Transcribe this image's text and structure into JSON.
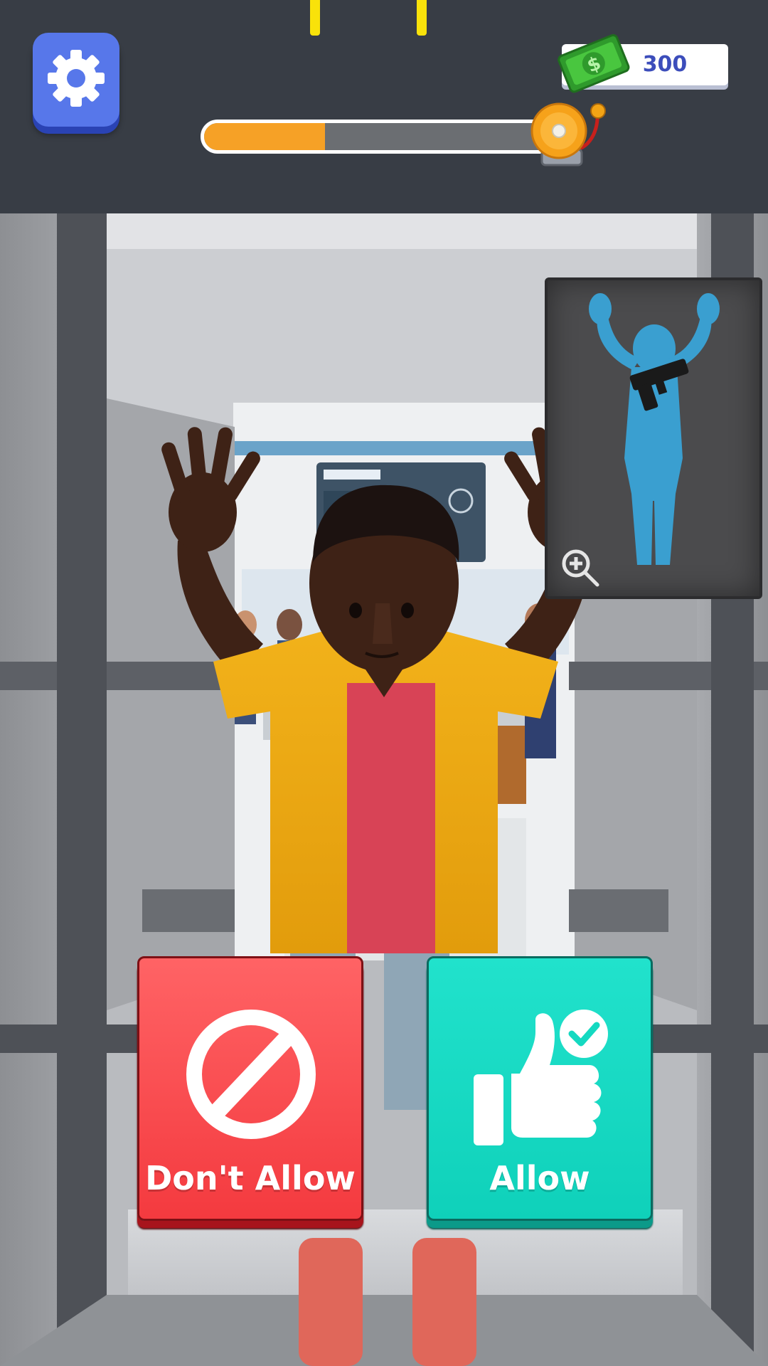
{
  "hud": {
    "settings_icon": "gear-icon",
    "money": {
      "icon": "cash-bill-icon",
      "amount": "300"
    },
    "progress": {
      "fraction": 0.34,
      "milestones": 2,
      "goal_icon": "alarm-bell-icon"
    }
  },
  "xray": {
    "icon": "zoom-in-icon",
    "contraband_icon": "gun-icon",
    "silhouette_color": "#3a9fd0"
  },
  "buttons": {
    "deny": {
      "label": "Don't Allow",
      "icon": "prohibited-icon",
      "color": "#f43a3f"
    },
    "allow": {
      "label": "Allow",
      "icon": "thumbs-up-check-icon",
      "color": "#14d9c1"
    }
  },
  "colors": {
    "hud_bg": "#383d45",
    "settings_bg": "#5777ea",
    "progress_fill": "#f6a126",
    "milestone": "#f9e20a",
    "money_text": "#3c4dbb"
  }
}
